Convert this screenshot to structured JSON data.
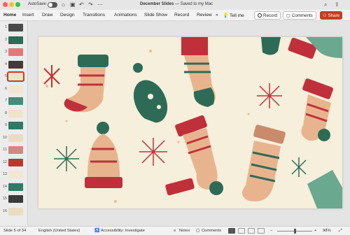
{
  "titlebar": {
    "autosave_label": "AutoSave",
    "doc_name": "December Slides",
    "doc_status": "— Saved to my Mac",
    "icons": [
      "home-icon",
      "save-icon",
      "undo-icon",
      "redo-icon",
      "more-icon",
      "search-icon",
      "share-icon"
    ]
  },
  "ribbon": {
    "tabs": [
      "Home",
      "Insert",
      "Draw",
      "Design",
      "Transitions",
      "Animations",
      "Slide Show",
      "Record",
      "Review"
    ],
    "tell_me": "Tell me",
    "record_button": "Record",
    "comments_button": "Comments",
    "share_button": "Share"
  },
  "thumbnails": {
    "selected": 5,
    "items": [
      {
        "num": "1",
        "color": "#4a4a4a"
      },
      {
        "num": "2",
        "color": "#2e6b57"
      },
      {
        "num": "3",
        "color": "#e07a7a"
      },
      {
        "num": "4",
        "color": "#3d3d3d"
      },
      {
        "num": "5",
        "color": "#f0e3c8"
      },
      {
        "num": "6",
        "color": "#f3e5cf"
      },
      {
        "num": "7",
        "color": "#4b8a76"
      },
      {
        "num": "8",
        "color": "#efe3c8"
      },
      {
        "num": "9",
        "color": "#2f7a62"
      },
      {
        "num": "10",
        "color": "#e9dcc2"
      },
      {
        "num": "11",
        "color": "#d88484"
      },
      {
        "num": "12",
        "color": "#b8392e"
      },
      {
        "num": "13",
        "color": "#f2e7d1"
      },
      {
        "num": "14",
        "color": "#2f7a62"
      },
      {
        "num": "15",
        "color": "#3a3a3a"
      },
      {
        "num": "16",
        "color": "#e9dcc2"
      }
    ]
  },
  "statusbar": {
    "slide_indicator": "Slide 5 of 34",
    "language": "English (United States)",
    "accessibility": "Accessibility: Investigate",
    "notes": "Notes",
    "comments": "Comments",
    "zoom": "98%"
  },
  "colors": {
    "slide_bg": "#f6efdb",
    "red": "#c0303a",
    "green": "#2e6b57",
    "tan": "#e8b48e",
    "share": "#c43e1c"
  }
}
